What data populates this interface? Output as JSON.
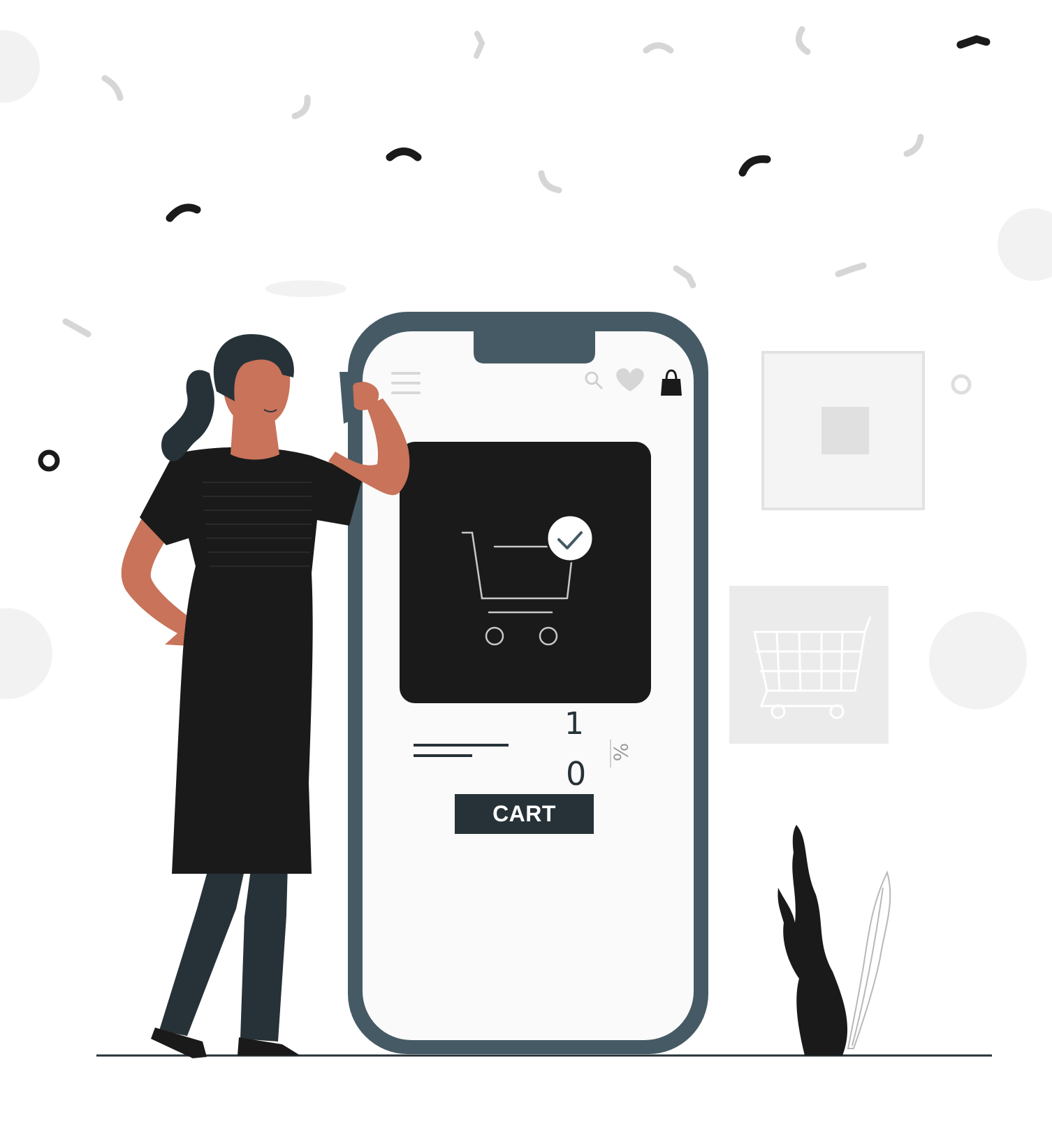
{
  "illustration": {
    "cart_button_label": "CART",
    "quantity_top": "1",
    "quantity_bottom": "0",
    "percent_symbol": "%"
  },
  "colors": {
    "phone_frame": "#455a64",
    "dark": "#1a1a1a",
    "navy": "#263238",
    "skin": "#c8735a",
    "light_gray": "#ebebeb",
    "mid_gray": "#c7c7c7",
    "background": "#ffffff"
  },
  "icons": [
    "hamburger-menu-icon",
    "search-icon",
    "heart-icon",
    "shopping-bag-icon",
    "shopping-cart-icon",
    "check-icon",
    "plant-icon"
  ]
}
